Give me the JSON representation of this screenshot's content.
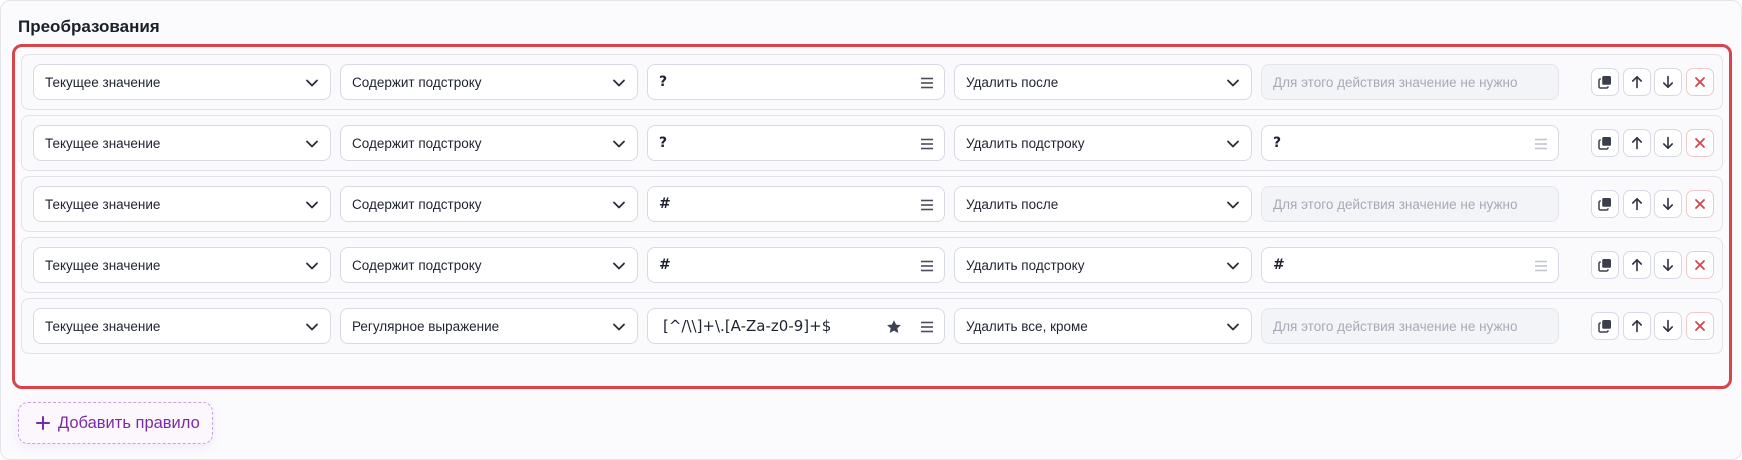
{
  "section": {
    "title": "Преобразования"
  },
  "rules": [
    {
      "field": "Текущее значение",
      "condition": "Содержит подстроку",
      "pattern": "?",
      "pattern_starred": false,
      "action": "Удалить после",
      "value": "",
      "value_placeholder": "Для этого действия значение не нужно",
      "value_disabled": true
    },
    {
      "field": "Текущее значение",
      "condition": "Содержит подстроку",
      "pattern": "?",
      "pattern_starred": false,
      "action": "Удалить подстроку",
      "value": "?",
      "value_placeholder": "",
      "value_disabled": false
    },
    {
      "field": "Текущее значение",
      "condition": "Содержит подстроку",
      "pattern": "#",
      "pattern_starred": false,
      "action": "Удалить после",
      "value": "",
      "value_placeholder": "Для этого действия значение не нужно",
      "value_disabled": true
    },
    {
      "field": "Текущее значение",
      "condition": "Содержит подстроку",
      "pattern": "#",
      "pattern_starred": false,
      "action": "Удалить подстроку",
      "value": "#",
      "value_placeholder": "",
      "value_disabled": false
    },
    {
      "field": "Текущее значение",
      "condition": "Регулярное выражение",
      "pattern": "[^/\\\\]+\\.[A-Za-z0-9]+$",
      "pattern_starred": true,
      "action": "Удалить все, кроме",
      "value": "",
      "value_placeholder": "Для этого действия значение не нужно",
      "value_disabled": true
    }
  ],
  "icons": {
    "select_chevron": "chevron-down-icon",
    "pattern_menu": "menu-icon",
    "star": "star-icon",
    "copy": "copy-icon",
    "move_up": "arrow-up-icon",
    "move_down": "arrow-down-icon",
    "delete": "close-icon",
    "add": "plus-icon"
  },
  "colors": {
    "highlight_border": "#d9434a",
    "delete_icon": "#d9434a",
    "add_button_text": "#7a2aa6",
    "add_button_border": "#c9a0dd"
  },
  "add_rule_label": "Добавить правило"
}
